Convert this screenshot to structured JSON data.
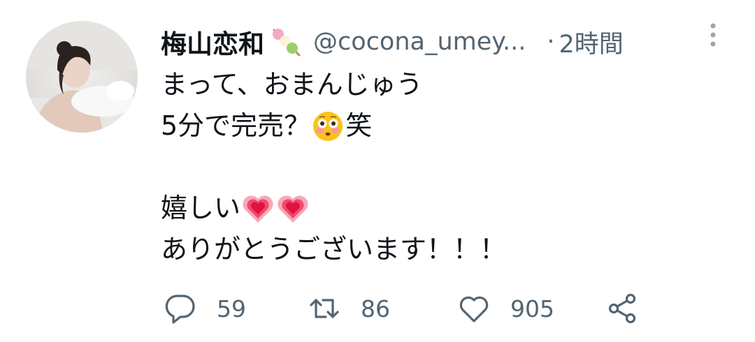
{
  "tweet": {
    "author": {
      "display_name": "梅山恋和",
      "name_emoji": "dango-emoji",
      "handle": "@cocona_umey...",
      "avatar": "profile-photo"
    },
    "separator": "·",
    "timestamp": "2時間",
    "more_icon": "more-vertical-icon",
    "lines": {
      "l1": "まって、おまんじゅう",
      "l2_text": "5分で完売？",
      "l2_emoji": "flushed-face-emoji",
      "l2_tail": "笑",
      "l3": "",
      "l4_text": "嬉しい",
      "l4_emoji": "growing-heart-emoji",
      "l5": "ありがとうございます！！！"
    },
    "actions": {
      "reply": {
        "icon": "reply-icon",
        "count": "59"
      },
      "retweet": {
        "icon": "retweet-icon",
        "count": "86"
      },
      "like": {
        "icon": "heart-icon",
        "count": "905"
      },
      "share": {
        "icon": "share-icon"
      }
    }
  },
  "colors": {
    "text": "#0f1419",
    "secondary": "#536471"
  }
}
